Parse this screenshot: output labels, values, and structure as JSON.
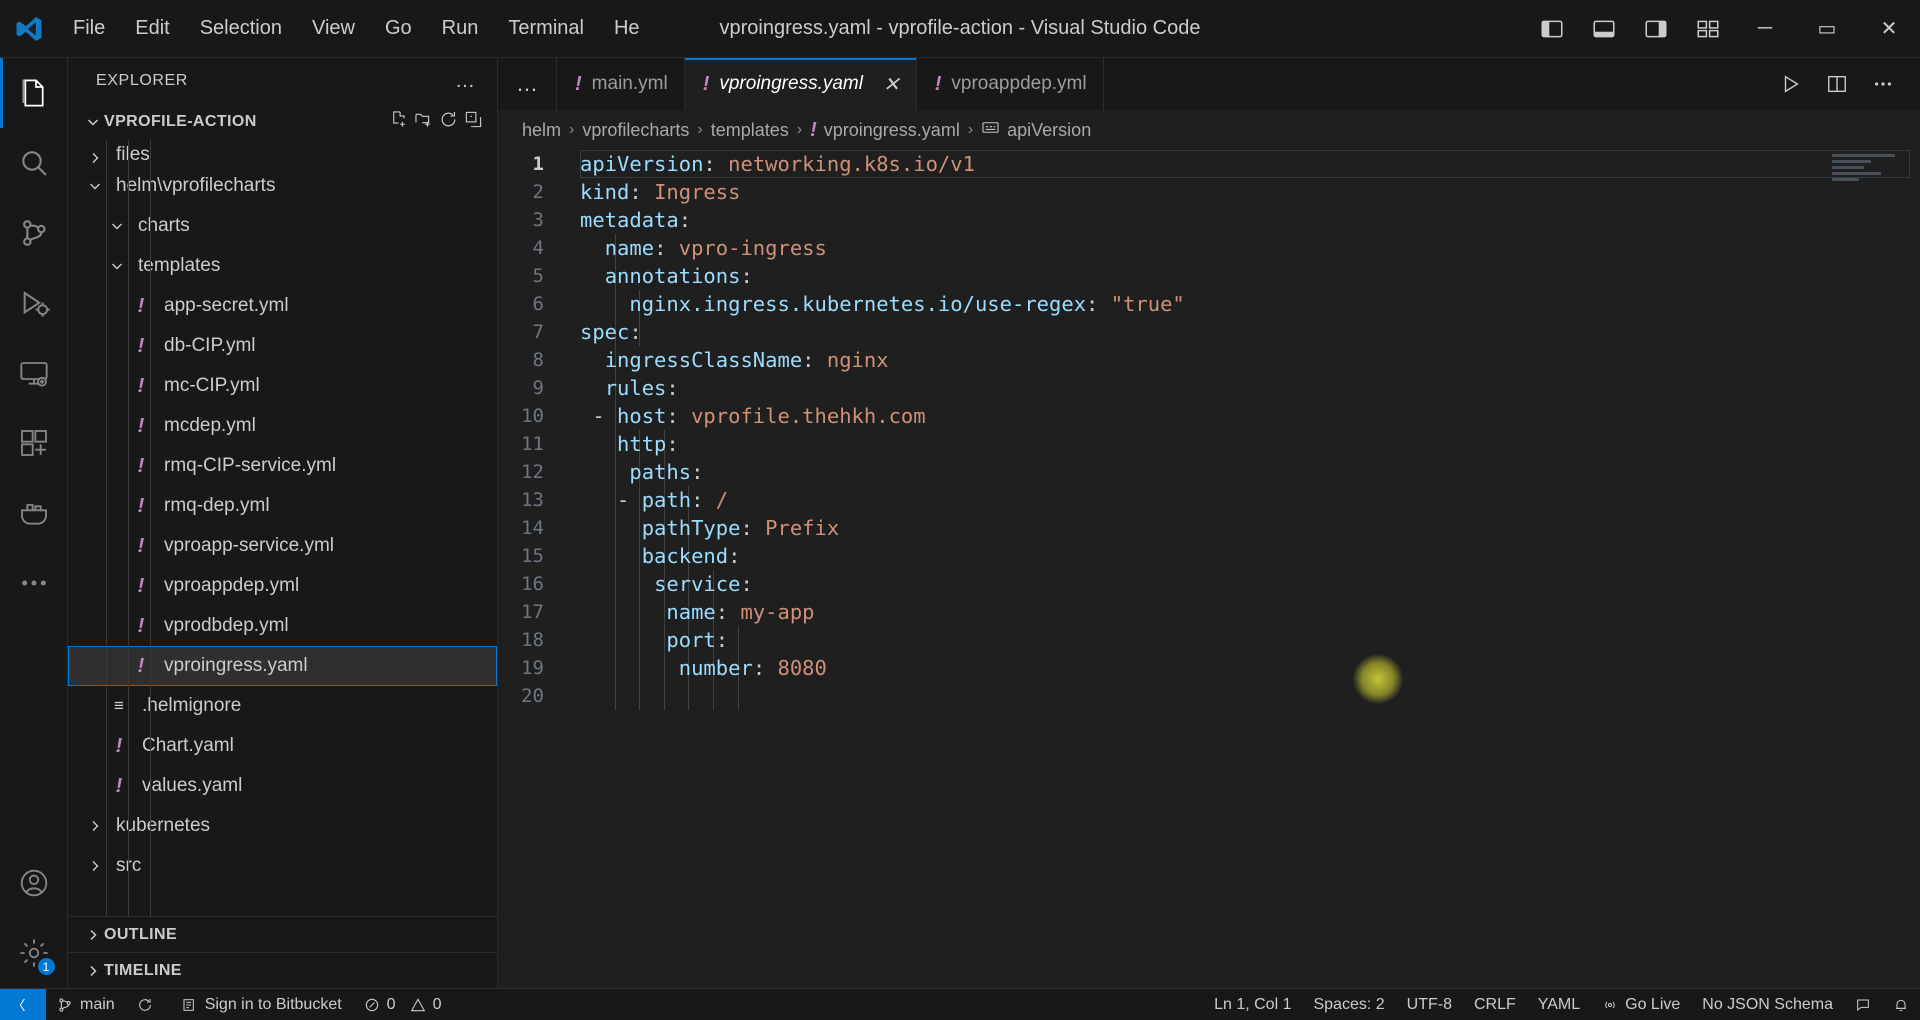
{
  "titlebar": {
    "menu": [
      "File",
      "Edit",
      "Selection",
      "View",
      "Go",
      "Run",
      "Terminal",
      "He"
    ],
    "window_title": "vproingress.yaml - vprofile-action - Visual Studio Code",
    "layout_icons": [
      "toggle-primary-sidebar-icon",
      "toggle-panel-icon",
      "toggle-secondary-sidebar-icon",
      "customize-layout-icon"
    ],
    "window_controls": {
      "minimize": "─",
      "maximize": "▭",
      "close": "✕"
    }
  },
  "activitybar": {
    "items": [
      {
        "name": "explorer",
        "active": true
      },
      {
        "name": "search",
        "active": false
      },
      {
        "name": "source-control",
        "active": false
      },
      {
        "name": "run-and-debug",
        "active": false
      },
      {
        "name": "remote-explorer",
        "active": false
      },
      {
        "name": "extensions",
        "active": false
      },
      {
        "name": "docker",
        "active": false
      },
      {
        "name": "more-views",
        "active": false
      }
    ],
    "bottom": [
      {
        "name": "accounts",
        "badge": null
      },
      {
        "name": "manage-settings",
        "badge": "1"
      }
    ]
  },
  "sidebar": {
    "header_title": "EXPLORER",
    "header_more": "…",
    "folder_section": {
      "label": "VPROFILE-ACTION",
      "actions": [
        "new-file-icon",
        "new-folder-icon",
        "refresh-icon",
        "collapse-all-icon"
      ]
    },
    "tree": [
      {
        "label": "files",
        "type": "folder",
        "depth": 1,
        "expanded": false,
        "clipped": true
      },
      {
        "label": "helm\\vprofilecharts",
        "type": "folder",
        "depth": 1,
        "expanded": true
      },
      {
        "label": "charts",
        "type": "folder",
        "depth": 2,
        "expanded": true
      },
      {
        "label": "templates",
        "type": "folder",
        "depth": 2,
        "expanded": true
      },
      {
        "label": "app-secret.yml",
        "type": "yaml",
        "depth": 3
      },
      {
        "label": "db-CIP.yml",
        "type": "yaml",
        "depth": 3
      },
      {
        "label": "mc-CIP.yml",
        "type": "yaml",
        "depth": 3
      },
      {
        "label": "mcdep.yml",
        "type": "yaml",
        "depth": 3
      },
      {
        "label": "rmq-CIP-service.yml",
        "type": "yaml",
        "depth": 3
      },
      {
        "label": "rmq-dep.yml",
        "type": "yaml",
        "depth": 3
      },
      {
        "label": "vproapp-service.yml",
        "type": "yaml",
        "depth": 3
      },
      {
        "label": "vproappdep.yml",
        "type": "yaml",
        "depth": 3
      },
      {
        "label": "vprodbdep.yml",
        "type": "yaml",
        "depth": 3
      },
      {
        "label": "vproingress.yaml",
        "type": "yaml",
        "depth": 3,
        "selected": true
      },
      {
        "label": ".helmignore",
        "type": "text",
        "depth": 2
      },
      {
        "label": "Chart.yaml",
        "type": "yaml",
        "depth": 2
      },
      {
        "label": "values.yaml",
        "type": "yaml",
        "depth": 2
      },
      {
        "label": "kubernetes",
        "type": "folder",
        "depth": 1,
        "expanded": false
      },
      {
        "label": "src",
        "type": "folder",
        "depth": 1,
        "expanded": false
      }
    ],
    "panels": [
      {
        "label": "OUTLINE"
      },
      {
        "label": "TIMELINE"
      }
    ]
  },
  "editor": {
    "tabs": [
      {
        "label": "main.yml",
        "active": false,
        "icon": "yaml-icon"
      },
      {
        "label": "vproingress.yaml",
        "active": true,
        "icon": "yaml-icon",
        "close": "✕"
      },
      {
        "label": "vproappdep.yml",
        "active": false,
        "icon": "yaml-icon"
      }
    ],
    "tabs_overflow": "…",
    "actions": [
      "run-icon",
      "split-editor-icon",
      "more-actions-icon"
    ],
    "breadcrumb": [
      {
        "label": "helm",
        "icon": null
      },
      {
        "label": "vprofilecharts",
        "icon": null
      },
      {
        "label": "templates",
        "icon": null
      },
      {
        "label": "vproingress.yaml",
        "icon": "yaml-icon"
      },
      {
        "label": "apiVersion",
        "icon": "field-icon"
      }
    ],
    "breadcrumb_separator": "›",
    "lines": [
      {
        "n": "1",
        "indent": 0,
        "tokens": [
          {
            "t": "apiVersion",
            "c": "k"
          },
          {
            "t": ": ",
            "c": "p"
          },
          {
            "t": "networking.k8s.io/v1",
            "c": "v"
          }
        ]
      },
      {
        "n": "2",
        "indent": 0,
        "tokens": [
          {
            "t": "kind",
            "c": "k"
          },
          {
            "t": ": ",
            "c": "p"
          },
          {
            "t": "Ingress",
            "c": "v"
          }
        ]
      },
      {
        "n": "3",
        "indent": 0,
        "tokens": [
          {
            "t": "metadata",
            "c": "k"
          },
          {
            "t": ":",
            "c": "p"
          }
        ]
      },
      {
        "n": "4",
        "indent": 2,
        "tokens": [
          {
            "t": "name",
            "c": "k"
          },
          {
            "t": ": ",
            "c": "p"
          },
          {
            "t": "vpro-ingress",
            "c": "v"
          }
        ]
      },
      {
        "n": "5",
        "indent": 2,
        "tokens": [
          {
            "t": "annotations",
            "c": "k"
          },
          {
            "t": ":",
            "c": "p"
          }
        ]
      },
      {
        "n": "6",
        "indent": 4,
        "tokens": [
          {
            "t": "nginx.ingress.kubernetes.io/use-regex",
            "c": "k"
          },
          {
            "t": ": ",
            "c": "p"
          },
          {
            "t": "\"true\"",
            "c": "v"
          }
        ]
      },
      {
        "n": "7",
        "indent": 0,
        "tokens": [
          {
            "t": "spec",
            "c": "k"
          },
          {
            "t": ":",
            "c": "p"
          }
        ]
      },
      {
        "n": "8",
        "indent": 2,
        "tokens": [
          {
            "t": "ingressClassName",
            "c": "k"
          },
          {
            "t": ": ",
            "c": "p"
          },
          {
            "t": "nginx",
            "c": "v"
          }
        ]
      },
      {
        "n": "9",
        "indent": 2,
        "tokens": [
          {
            "t": "rules",
            "c": "k"
          },
          {
            "t": ":",
            "c": "p"
          }
        ]
      },
      {
        "n": "10",
        "indent": 1,
        "tokens": [
          {
            "t": "- ",
            "c": "d"
          },
          {
            "t": "host",
            "c": "k"
          },
          {
            "t": ": ",
            "c": "p"
          },
          {
            "t": "vprofile.thehkh.com",
            "c": "v"
          }
        ]
      },
      {
        "n": "11",
        "indent": 3,
        "tokens": [
          {
            "t": "http",
            "c": "k"
          },
          {
            "t": ":",
            "c": "p"
          }
        ]
      },
      {
        "n": "12",
        "indent": 4,
        "tokens": [
          {
            "t": "paths",
            "c": "k"
          },
          {
            "t": ":",
            "c": "p"
          }
        ]
      },
      {
        "n": "13",
        "indent": 3,
        "tokens": [
          {
            "t": "- ",
            "c": "d"
          },
          {
            "t": "path",
            "c": "k"
          },
          {
            "t": ": ",
            "c": "p"
          },
          {
            "t": "/",
            "c": "v"
          }
        ]
      },
      {
        "n": "14",
        "indent": 5,
        "tokens": [
          {
            "t": "pathType",
            "c": "k"
          },
          {
            "t": ": ",
            "c": "p"
          },
          {
            "t": "Prefix",
            "c": "v"
          }
        ]
      },
      {
        "n": "15",
        "indent": 5,
        "tokens": [
          {
            "t": "backend",
            "c": "k"
          },
          {
            "t": ":",
            "c": "p"
          }
        ]
      },
      {
        "n": "16",
        "indent": 6,
        "tokens": [
          {
            "t": "service",
            "c": "k"
          },
          {
            "t": ":",
            "c": "p"
          }
        ]
      },
      {
        "n": "17",
        "indent": 7,
        "tokens": [
          {
            "t": "name",
            "c": "k"
          },
          {
            "t": ": ",
            "c": "p"
          },
          {
            "t": "my-app",
            "c": "v"
          }
        ]
      },
      {
        "n": "18",
        "indent": 7,
        "tokens": [
          {
            "t": "port",
            "c": "k"
          },
          {
            "t": ":",
            "c": "p"
          }
        ]
      },
      {
        "n": "19",
        "indent": 8,
        "tokens": [
          {
            "t": "number",
            "c": "k"
          },
          {
            "t": ": ",
            "c": "p"
          },
          {
            "t": "8080",
            "c": "v"
          }
        ]
      },
      {
        "n": "20",
        "indent": 0,
        "tokens": []
      }
    ]
  },
  "statusbar": {
    "left": [
      {
        "label": "main",
        "icon": "source-control-branch-icon"
      },
      {
        "label": "",
        "icon": "sync-icon"
      },
      {
        "label": "Sign in to Bitbucket",
        "icon": "bitbucket-icon"
      },
      {
        "label": "0",
        "icon": "error-icon"
      },
      {
        "label": "0",
        "icon": "warning-icon"
      }
    ],
    "right": [
      {
        "label": "Ln 1, Col 1",
        "icon": null
      },
      {
        "label": "Spaces: 2",
        "icon": null
      },
      {
        "label": "UTF-8",
        "icon": null
      },
      {
        "label": "CRLF",
        "icon": null
      },
      {
        "label": "YAML",
        "icon": null
      },
      {
        "label": "Go Live",
        "icon": "broadcast-icon"
      },
      {
        "label": "No JSON Schema",
        "icon": null
      },
      {
        "label": "",
        "icon": "feedback-icon"
      },
      {
        "label": "",
        "icon": "bell-icon"
      }
    ]
  },
  "colors": {
    "accent": "#0078d4",
    "bg": "#1f1f1f",
    "chrome_bg": "#181818",
    "yaml_icon": "#c586c0",
    "key": "#9cdcfe",
    "value": "#ce9178",
    "click_highlight": "#e2e23c"
  }
}
